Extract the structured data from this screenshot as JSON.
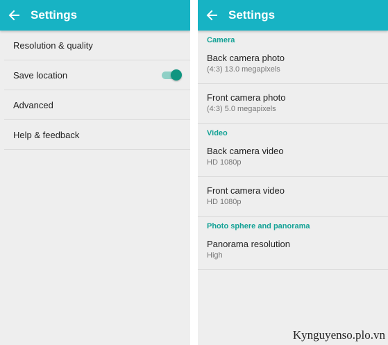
{
  "left": {
    "title": "Settings",
    "items": [
      {
        "label": "Resolution & quality"
      },
      {
        "label": "Save location",
        "toggle_on": true
      },
      {
        "label": "Advanced"
      },
      {
        "label": "Help & feedback"
      }
    ]
  },
  "right": {
    "title": "Settings",
    "sections": [
      {
        "header": "Camera",
        "items": [
          {
            "title": "Back camera photo",
            "subtitle": "(4:3) 13.0 megapixels"
          },
          {
            "title": "Front camera photo",
            "subtitle": "(4:3) 5.0 megapixels"
          }
        ]
      },
      {
        "header": "Video",
        "items": [
          {
            "title": "Back camera video",
            "subtitle": "HD 1080p"
          },
          {
            "title": "Front camera video",
            "subtitle": "HD 1080p"
          }
        ]
      },
      {
        "header": "Photo sphere and panorama",
        "items": [
          {
            "title": "Panorama resolution",
            "subtitle": "High"
          }
        ]
      }
    ]
  },
  "watermark": "Kynguyenso.plo.vn",
  "colors": {
    "appbar": "#17b3c4",
    "accent": "#14a296",
    "background": "#eeeeee",
    "toggle_thumb": "#0f9580",
    "toggle_track": "#8fd0c6"
  },
  "icons": {
    "back": "arrow-left-icon"
  }
}
